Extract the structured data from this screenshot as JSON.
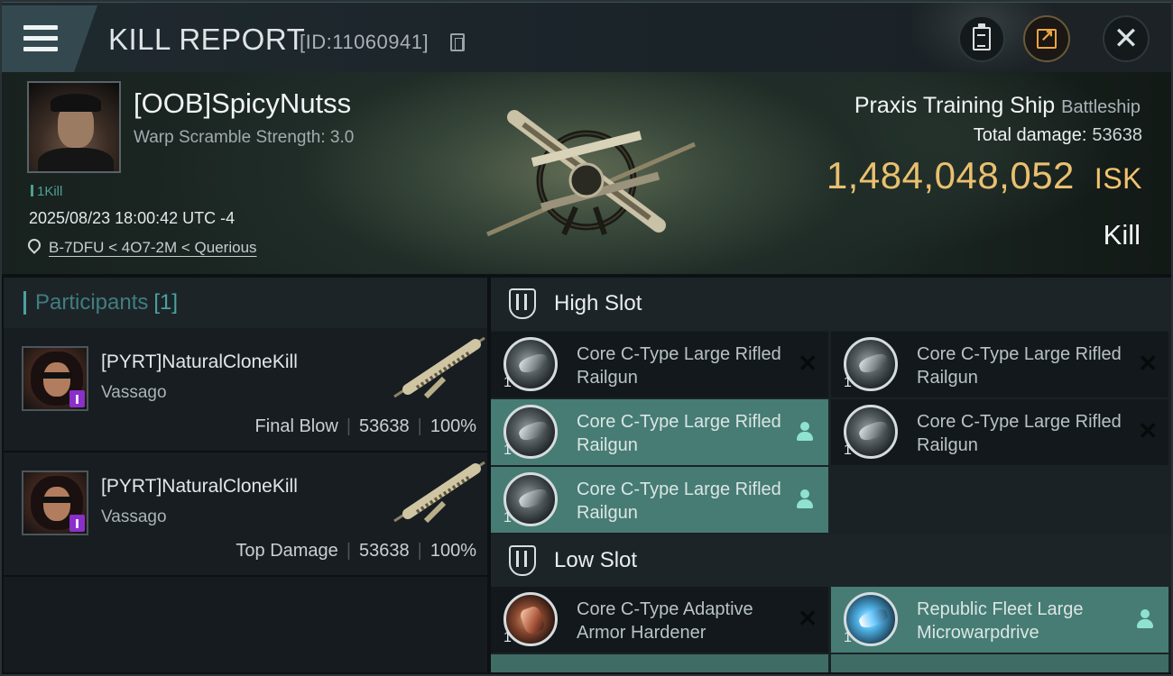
{
  "header": {
    "title": "KILL REPORT",
    "report_id": "[ID:11060941]",
    "icons": [
      "menu-icon",
      "copy-icon",
      "clipboard-icon",
      "share-icon",
      "close-icon"
    ]
  },
  "victim": {
    "name": "[OOB]SpicyNutss",
    "warp_scramble": "Warp Scramble Strength: 3.0",
    "kill_count": "1Kill",
    "timestamp": "2025/08/23 18:00:42 UTC -4",
    "location": "B-7DFU < 4O7-2M < Querious",
    "ship_name": "Praxis Training Ship",
    "ship_class": "Battleship",
    "total_damage_label": "Total damage:",
    "total_damage": "53638",
    "isk_value": "1,484,048,052",
    "isk_unit": "ISK",
    "result": "Kill"
  },
  "participants": {
    "label": "Participants",
    "count": "[1]",
    "items": [
      {
        "name": "[PYRT]NaturalCloneKill",
        "corp": "Vassago",
        "role": "Final Blow",
        "damage": "53638",
        "percent": "100%"
      },
      {
        "name": "[PYRT]NaturalCloneKill",
        "corp": "Vassago",
        "role": "Top Damage",
        "damage": "53638",
        "percent": "100%"
      }
    ]
  },
  "fitting": {
    "high_slot_label": "High Slot",
    "low_slot_label": "Low Slot",
    "high_slot": [
      {
        "name": "Core C-Type Large Rifled Railgun",
        "qty": "1",
        "status": "destroyed"
      },
      {
        "name": "Core C-Type Large Rifled Railgun",
        "qty": "1",
        "status": "destroyed"
      },
      {
        "name": "Core C-Type Large Rifled Railgun",
        "qty": "1",
        "status": "dropped"
      },
      {
        "name": "Core C-Type Large Rifled Railgun",
        "qty": "1",
        "status": "destroyed"
      },
      {
        "name": "Core C-Type Large Rifled Railgun",
        "qty": "1",
        "status": "dropped"
      }
    ],
    "low_slot": [
      {
        "name": "Core C-Type Adaptive Armor Hardener",
        "qty": "1",
        "status": "destroyed"
      },
      {
        "name": "Republic Fleet Large Microwarpdrive",
        "qty": "1",
        "status": "dropped"
      }
    ]
  },
  "colors": {
    "isk_gold": "#e9c06f",
    "dropped_teal": "#467c74",
    "accent_teal": "#4aa2a0"
  }
}
